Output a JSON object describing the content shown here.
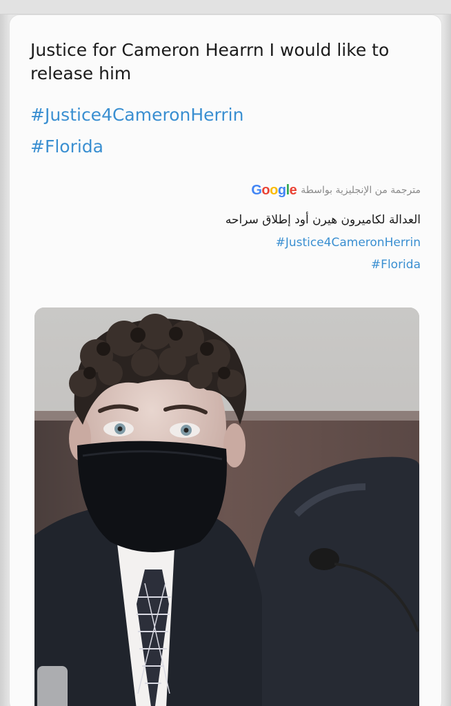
{
  "tweet": {
    "text": "Justice for Cameron Hearrn I would like to release him",
    "hashtags": [
      "#Justice4CameronHerrin",
      "#Florida"
    ]
  },
  "translation": {
    "label": "مترجمة من الإنجليزية بواسطة",
    "provider": "Google",
    "text": "العدالة لكاميرون هيرن أود إطلاق سراحه",
    "hashtags": [
      "#Justice4CameronHerrin",
      "#Florida"
    ]
  },
  "colors": {
    "hashtag": "#3a8fd1",
    "text": "#1b1b1b",
    "muted": "#8a8a8a"
  },
  "media": {
    "description_icon": "photo"
  }
}
